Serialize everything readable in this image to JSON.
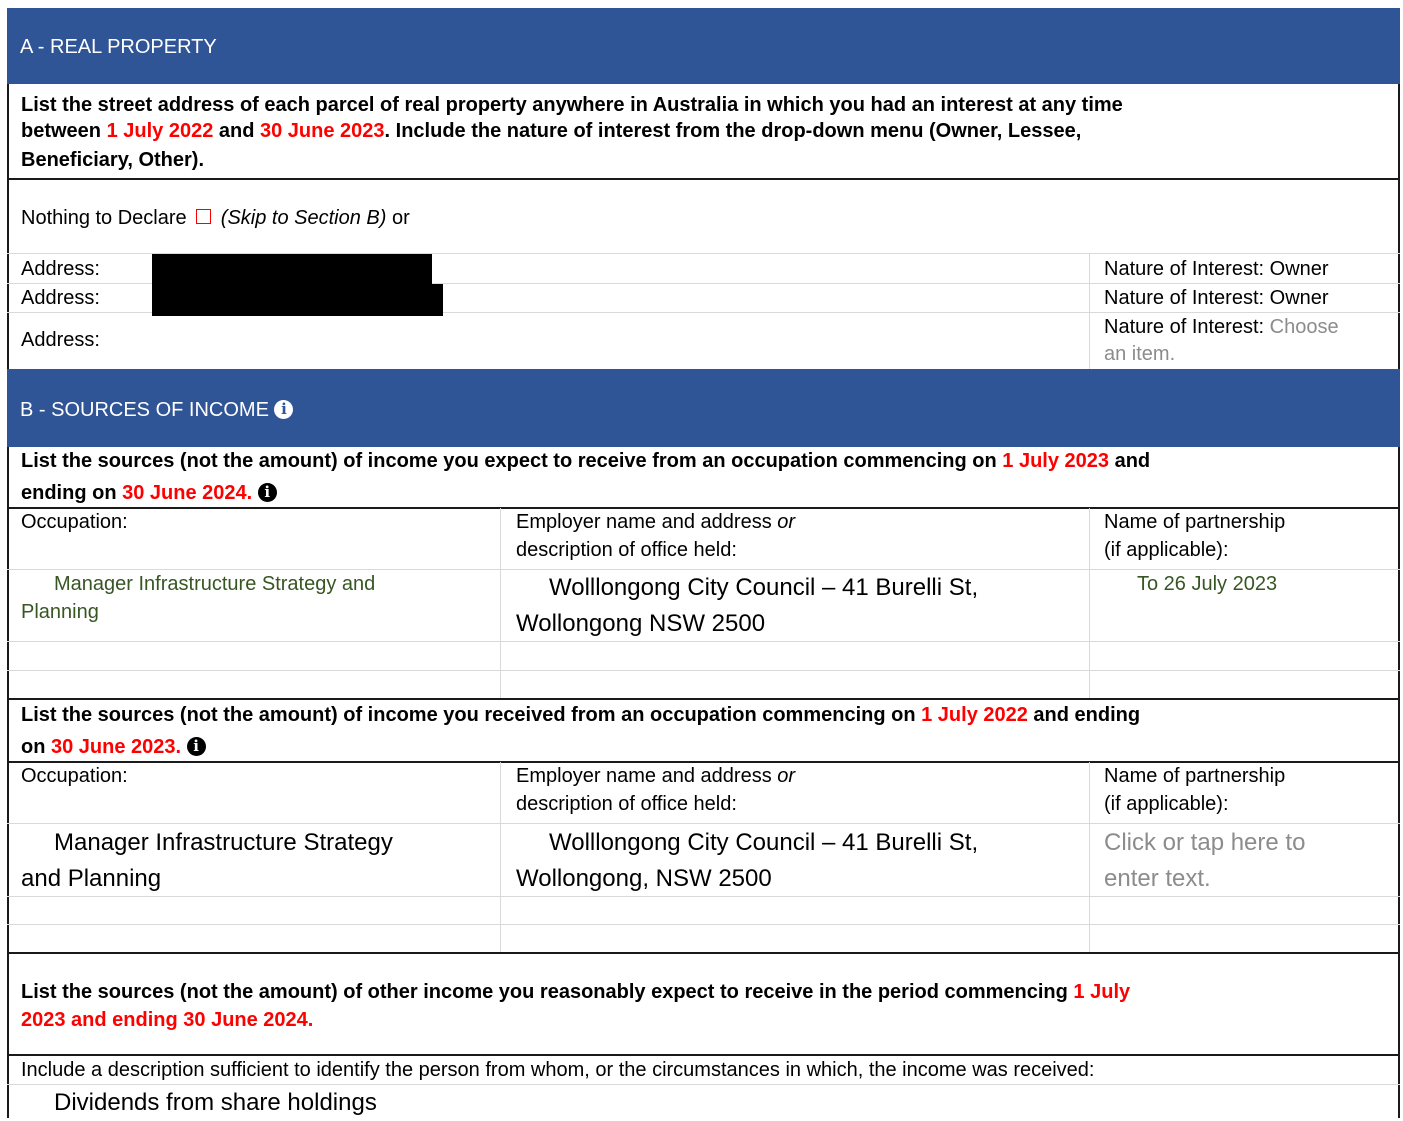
{
  "section_a": {
    "header": "A - REAL PROPERTY",
    "intro_1": "List the street address of each parcel of real property anywhere in Australia in which you had an interest at any time",
    "intro_2a": "between ",
    "intro_2_date1": "1 July 2022",
    "intro_2b": " and ",
    "intro_2_date2": "30 June 2023",
    "intro_2c": ". Include the nature of interest from the drop-down menu (Owner, Lessee,",
    "intro_3": "Beneficiary, Other).",
    "nothing_label": "Nothing to Declare",
    "skip_label": "(Skip to Section B)",
    "or_label": " or",
    "address_label": "Address:",
    "interest_label": "Nature of Interest:",
    "rows": [
      {
        "interest_value": "Owner"
      },
      {
        "interest_value": "Owner"
      },
      {
        "interest_value_1": "Choose",
        "interest_value_2": "an item."
      }
    ]
  },
  "section_b": {
    "header": "B - SOURCES OF INCOME",
    "q1_line1a": "List the sources (not the amount) of income you expect to receive from an occupation commencing on ",
    "q1_date1": "1 July 2023",
    "q1_line1b": " and",
    "q1_line2a": "ending on ",
    "q1_date2": "30 June 2024.",
    "occupation_label": "Occupation:",
    "employer_label_1a": "Employer name and address ",
    "employer_label_1b": "or",
    "employer_label_2": "description of office held:",
    "partnership_label_1": "Name of partnership",
    "partnership_label_2": "(if applicable):",
    "q1_entry": {
      "occupation_1": "Manager Infrastructure Strategy and",
      "occupation_2": "Planning",
      "employer_1": "Wolllongong City Council – 41 Burelli St,",
      "employer_2": "Wollongong NSW 2500",
      "partnership": "To 26 July 2023"
    },
    "q2_line1a": "List the sources (not the amount) of income you received from an occupation commencing on ",
    "q2_date1": "1 July 2022",
    "q2_line1b": " and ending",
    "q2_line2a": "on ",
    "q2_date2": "30 June 2023.",
    "q2_entry": {
      "occupation_1": "Manager Infrastructure Strategy",
      "occupation_2": "and Planning",
      "employer_1": "Wolllongong City Council – 41 Burelli St,",
      "employer_2": "Wollongong, NSW 2500",
      "partnership_1": "Click or tap here to",
      "partnership_2": "enter text."
    },
    "q3_line1a": "List the sources (not the amount) of other income you reasonably expect to receive in the period commencing ",
    "q3_line1b": "1 July",
    "q3_line2": "2023 and ending 30 June 2024.",
    "q3_desc": "Include a description sufficient to identify the person from whom, or the circumstances in which, the income was received:",
    "q3_entry": "Dividends from share holdings",
    "info_glyph": "i"
  }
}
